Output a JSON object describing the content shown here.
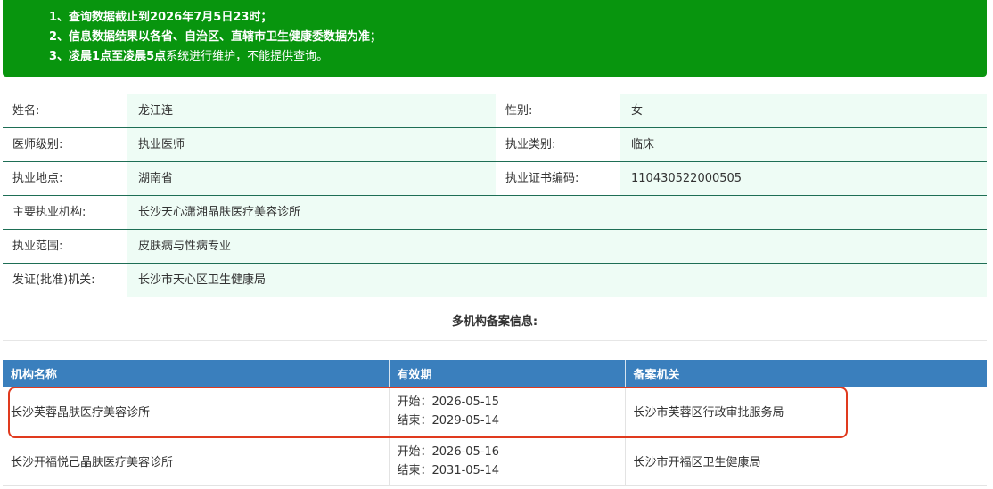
{
  "notice": {
    "line1": "1、查询数据截止到2026年7月5日23时；",
    "line2": "2、信息数据结果以各省、自治区、直辖市卫生健康委数据为准；",
    "line3_bold": "3、凌晨1点至凌晨5点",
    "line3_rest": "系统进行维护，不能提供查询。"
  },
  "info": {
    "name_label": "姓名:",
    "name": "龙江连",
    "gender_label": "性别:",
    "gender": "女",
    "level_label": "医师级别:",
    "level": "执业医师",
    "category_label": "执业类别:",
    "category": "临床",
    "location_label": "执业地点:",
    "location": "湖南省",
    "cert_label": "执业证书编码:",
    "cert": "110430522000505",
    "org_label": "主要执业机构:",
    "org": "长沙天心潇湘晶肤医疗美容诊所",
    "scope_label": "执业范围:",
    "scope": "皮肤病与性病专业",
    "authority_label": "发证(批准)机关:",
    "authority": "长沙市天心区卫生健康局"
  },
  "multi": {
    "title": "多机构备案信息:",
    "headers": [
      "机构名称",
      "有效期",
      "备案机关"
    ],
    "rows": [
      {
        "name": "长沙芙蓉晶肤医疗美容诊所",
        "start": "开始：2026-05-15",
        "end": "结束：2029-05-14",
        "office": "长沙市芙蓉区行政审批服务局"
      },
      {
        "name": "长沙开福悦己晶肤医疗美容诊所",
        "start": "开始：2026-05-16",
        "end": "结束：2031-05-14",
        "office": "长沙市开福区卫生健康局"
      }
    ]
  },
  "colors": {
    "notice_bg": "#08950e",
    "header_bg": "#3a7fbd",
    "highlight": "#e03a1e",
    "value_bg": "#eefcf5"
  }
}
